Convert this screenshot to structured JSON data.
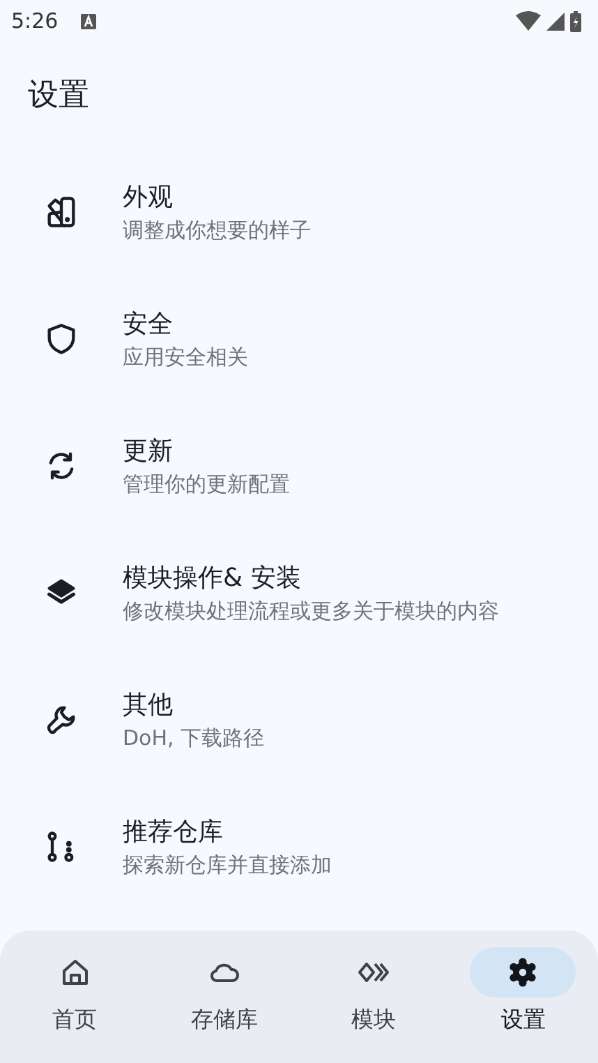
{
  "status_bar": {
    "time": "5:26"
  },
  "title": "设置",
  "items": [
    {
      "title": "外观",
      "subtitle": "调整成你想要的样子"
    },
    {
      "title": "安全",
      "subtitle": "应用安全相关"
    },
    {
      "title": "更新",
      "subtitle": "管理你的更新配置"
    },
    {
      "title": "模块操作& 安装",
      "subtitle": "修改模块处理流程或更多关于模块的内容"
    },
    {
      "title": "其他",
      "subtitle": "DoH, 下载路径"
    },
    {
      "title": "推荐仓库",
      "subtitle": "探索新仓库并直接添加"
    }
  ],
  "bottom_nav": [
    {
      "label": "首页",
      "selected": false
    },
    {
      "label": "存储库",
      "selected": false
    },
    {
      "label": "模块",
      "selected": false
    },
    {
      "label": "设置",
      "selected": true
    }
  ]
}
